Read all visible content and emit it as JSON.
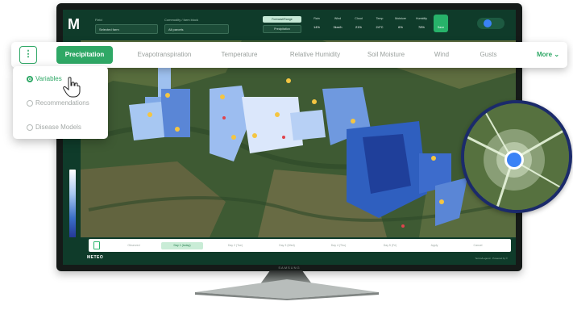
{
  "app": {
    "logo": "M",
    "footer_logo": "METEO",
    "footer_credits": "Terms/Legend · Powered by ©",
    "tv_brand": "SAMSUNG"
  },
  "topbar": {
    "field1_label": "Field",
    "field1_value": "Selected farm",
    "field2_label": "Commodity / farm block",
    "field2_value": "All parcels",
    "forecast_badge": "Forecast/Range",
    "forecast_select": "Precipitation",
    "metrics": [
      {
        "label": "Rain",
        "value": "14%"
      },
      {
        "label": "Wind",
        "value": "3km/h"
      },
      {
        "label": "Cloud",
        "value": "21%"
      },
      {
        "label": "Temp",
        "value": "24°C"
      },
      {
        "label": "Moisture",
        "value": "6%"
      },
      {
        "label": "Humidity",
        "value": "78%"
      }
    ],
    "action_label": "Save"
  },
  "tabs": [
    {
      "label": "Precipitation",
      "active": true
    },
    {
      "label": "Evapotranspiration",
      "active": false
    },
    {
      "label": "Temperature",
      "active": false
    },
    {
      "label": "Relative Humidity",
      "active": false
    },
    {
      "label": "Soil Moisture",
      "active": false
    },
    {
      "label": "Wind",
      "active": false
    },
    {
      "label": "Gusts",
      "active": false
    }
  ],
  "more_label": "More",
  "dropdown": {
    "options": [
      {
        "label": "Variables",
        "selected": true
      },
      {
        "label": "Recommendations",
        "selected": false
      },
      {
        "label": "Disease Models",
        "selected": false
      }
    ]
  },
  "days": [
    {
      "label": "Observed",
      "active": false
    },
    {
      "label": "Day 1 (today)",
      "active": true
    },
    {
      "label": "Day 2 (Tue)",
      "active": false
    },
    {
      "label": "Day 3 (Wed)",
      "active": false
    },
    {
      "label": "Day 4 (Thu)",
      "active": false
    },
    {
      "label": "Day 5 (Fri)",
      "active": false
    },
    {
      "label": "Apply",
      "active": false
    },
    {
      "label": "Cancel",
      "active": false
    }
  ],
  "colors": {
    "brand_green": "#2fa866",
    "topbar": "#0f3b2a",
    "precip_high": "#1f3f9a",
    "precip_low": "#e8f0ff",
    "marker": "#f4c542",
    "zoom_ring": "#1b2a6b",
    "location_dot": "#3b82f6"
  },
  "icons": [
    "menu-icon",
    "chevron-down-icon",
    "radio-icon",
    "hand-cursor-icon",
    "exit-icon",
    "calendar-icon",
    "location-dot-icon"
  ]
}
